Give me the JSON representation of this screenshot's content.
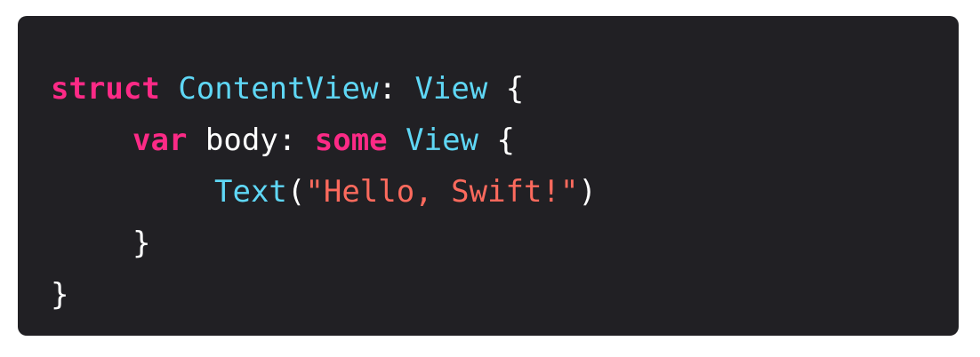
{
  "colors": {
    "background": "#212024",
    "keyword": "#fc2a86",
    "type": "#5fd7f5",
    "plain": "#ffffff",
    "string": "#fc6a5d"
  },
  "code": {
    "line1": {
      "kw_struct": "struct",
      "space1": " ",
      "type_name": "ContentView",
      "colon": ": ",
      "type_protocol": "View",
      "brace_open": " {"
    },
    "line2": {
      "kw_var": "var",
      "space1": " ",
      "ident": "body",
      "colon": ": ",
      "kw_some": "some",
      "space2": " ",
      "type_view": "View",
      "brace_open": " {"
    },
    "line3": {
      "type_text": "Text",
      "paren_open": "(",
      "string": "\"Hello, Swift!\"",
      "paren_close": ")"
    },
    "line4": {
      "brace_close": "}"
    },
    "line5": {
      "brace_close": "}"
    }
  }
}
